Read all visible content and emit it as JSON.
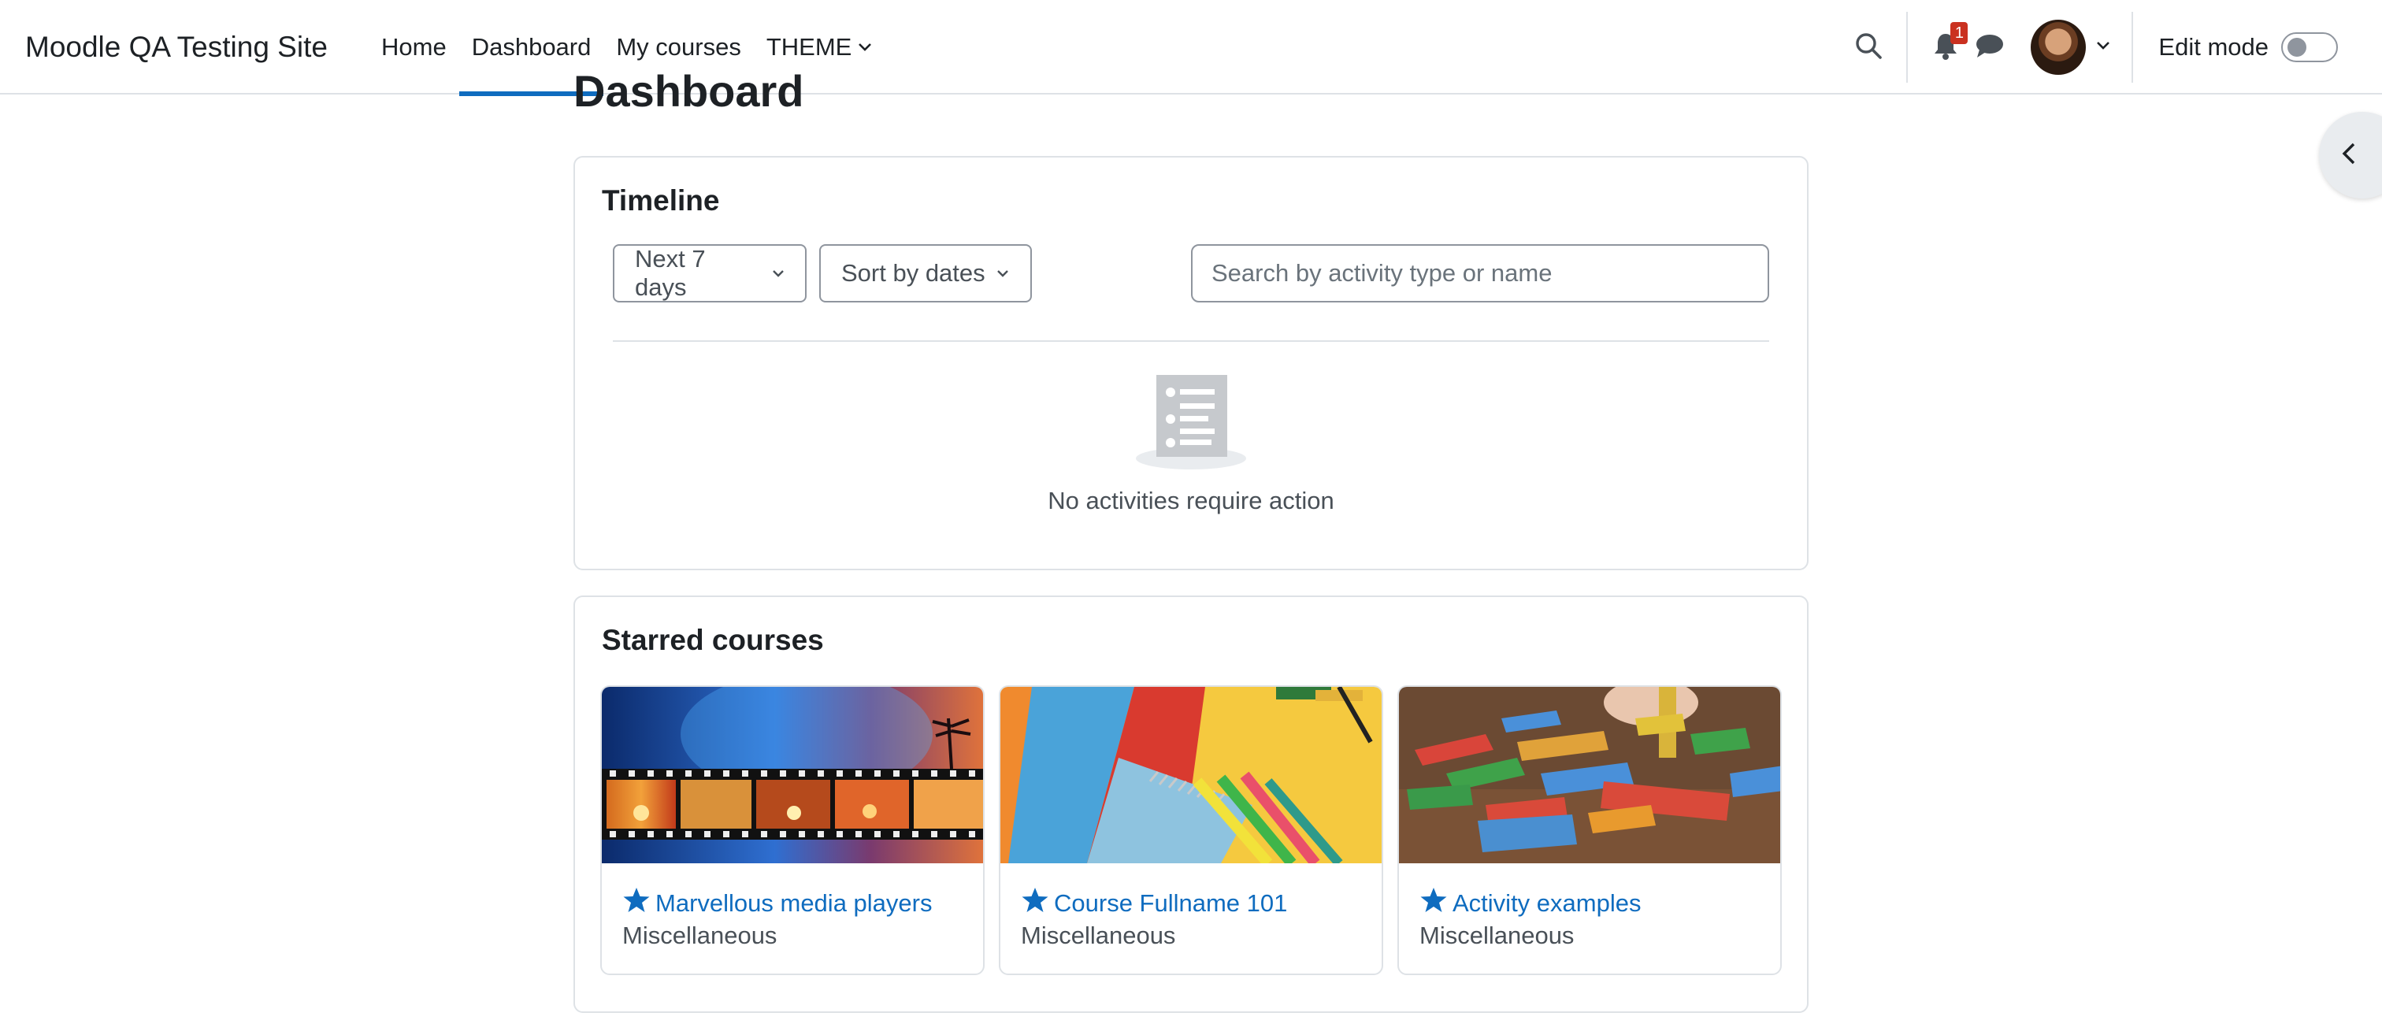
{
  "navbar": {
    "brand": "Moodle QA Testing Site",
    "links": [
      {
        "label": "Home",
        "active": false
      },
      {
        "label": "Dashboard",
        "active": true
      },
      {
        "label": "My courses",
        "active": false
      },
      {
        "label": "THEME",
        "active": false
      }
    ],
    "notification_count": "1",
    "edit_mode_label": "Edit mode",
    "edit_mode_on": false,
    "icons": [
      "search-icon",
      "bell-icon",
      "chat-icon",
      "avatar",
      "chevron-down-icon"
    ]
  },
  "page": {
    "title": "Dashboard"
  },
  "timeline": {
    "title": "Timeline",
    "filter_label": "Next 7 days",
    "sort_label": "Sort by dates",
    "search_placeholder": "Search by activity type or name",
    "empty_message": "No activities require action"
  },
  "starred": {
    "title": "Starred courses",
    "courses": [
      {
        "name": "Marvellous media players",
        "category": "Miscellaneous",
        "image": "film-strip-sunset"
      },
      {
        "name": "Course Fullname 101",
        "category": "Miscellaneous",
        "image": "paper-and-markers"
      },
      {
        "name": "Activity examples",
        "category": "Miscellaneous",
        "image": "wooden-blocks"
      }
    ]
  },
  "colors": {
    "link": "#0f6cbf",
    "text": "#1d2125",
    "muted": "#495057",
    "border": "#dee2e6",
    "badge": "#ca3120"
  }
}
